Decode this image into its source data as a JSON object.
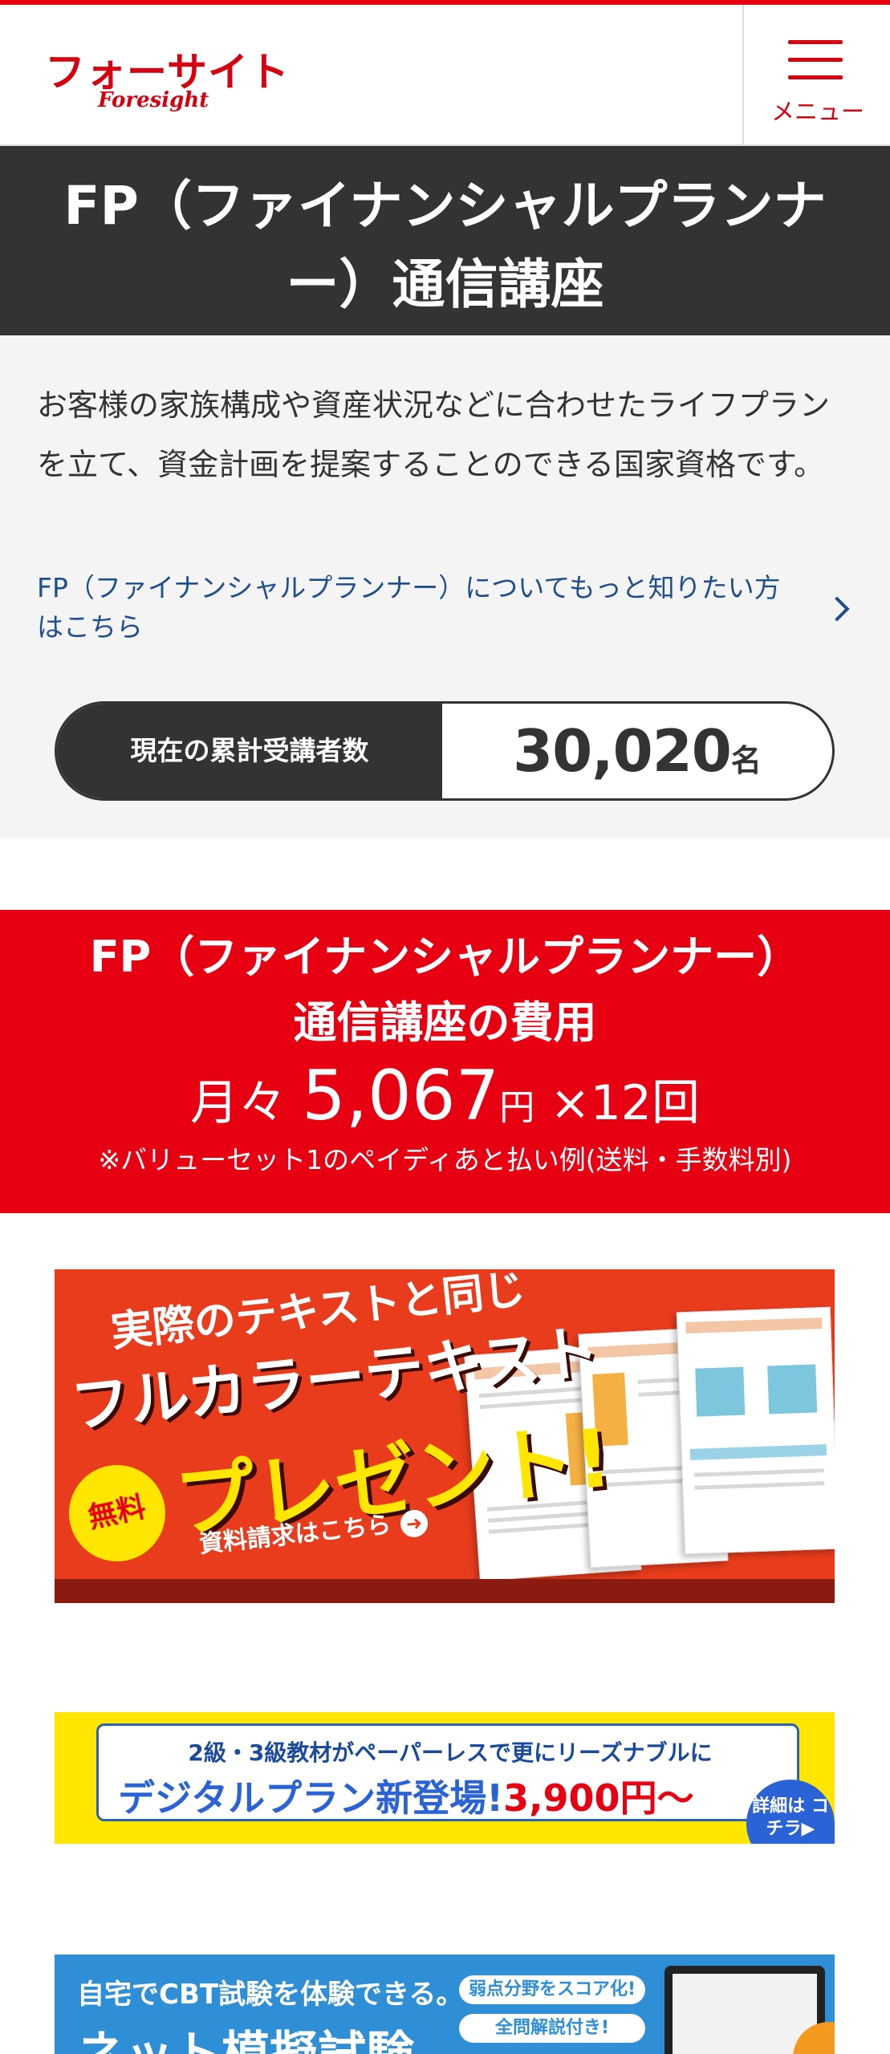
{
  "colors": {
    "brand_red": "#e60012",
    "dark": "#333333",
    "link_blue": "#1f4e8c",
    "panel_gray": "#f4f4f4"
  },
  "header": {
    "logo_jp": "フォーサイト",
    "logo_en": "Foresight",
    "menu_label": "メニュー",
    "menu_icon": "hamburger-icon"
  },
  "page": {
    "title": "FP（ファイナンシャルプランナー）通信講座",
    "description": "お客様の家族構成や資産状況などに合わせたライフプランを立て、資金計画を提案することのできる国家資格です。",
    "more_link": "FP（ファイナンシャルプランナー）についてもっと知りたい方はこちら",
    "more_link_icon": "chevron-right-icon"
  },
  "counter": {
    "label": "現在の累計受講者数",
    "value": "30,020",
    "unit": "名"
  },
  "price": {
    "title_line1": "FP（ファイナンシャルプランナー）",
    "title_line2": "通信講座の費用",
    "prefix": "月々",
    "amount": "5,067",
    "currency": "円",
    "times": "×12回",
    "note": "※バリューセット1のペイディあと払い例(送料・手数料別)"
  },
  "banner_text": {
    "top": "実際のテキストと同じ",
    "main": "フルカラーテキスト",
    "present": "プレゼント!",
    "free": "無料",
    "cta": "資料請求はこちら"
  },
  "banner_digital": {
    "top": "2級・3級教材がペーパーレスで更にリーズナブルに",
    "main": "デジタルプラン新登場!",
    "price": "3,900円〜",
    "detail": "詳細は コチラ▶"
  },
  "banner_mock": {
    "top": "自宅でCBT試験を体験できる。",
    "main": "ネット模擬試験",
    "pill1": "弱点分野をスコア化!",
    "pill2": "全問解説付き!"
  }
}
